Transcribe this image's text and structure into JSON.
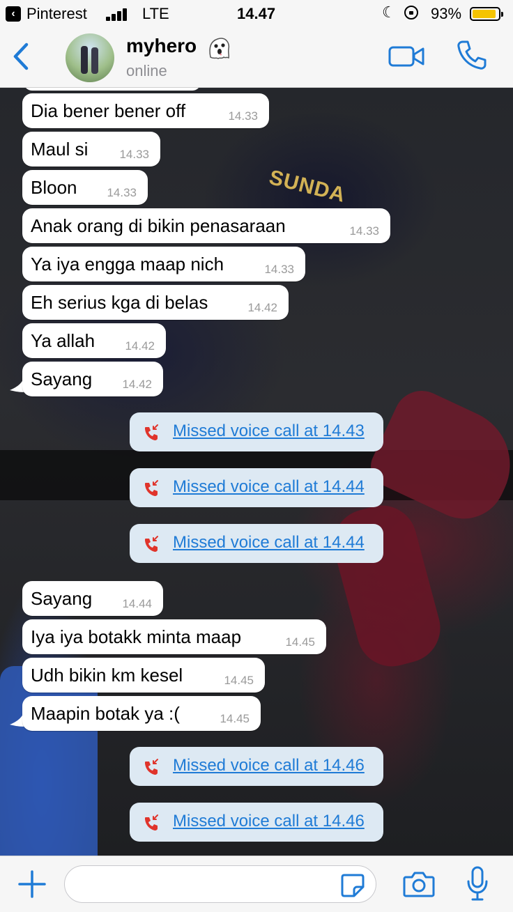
{
  "status_bar": {
    "back_app": "Pinterest",
    "network": "LTE",
    "time": "14.47",
    "battery_percent": "93%",
    "battery_level": 0.93
  },
  "header": {
    "contact_name": "myhero",
    "contact_status": "online",
    "icons": [
      "back-chevron-icon",
      "ghost-emoji-icon",
      "video-call-icon",
      "phone-icon"
    ]
  },
  "messages": [
    {
      "type": "text",
      "text": "Dia bener bener off",
      "time": "14.33"
    },
    {
      "type": "text",
      "text": "Maul si",
      "time": "14.33"
    },
    {
      "type": "text",
      "text": "Bloon",
      "time": "14.33"
    },
    {
      "type": "text",
      "text": "Anak orang di bikin penasaraan",
      "time": "14.33"
    },
    {
      "type": "text",
      "text": "Ya iya engga maap nich",
      "time": "14.33"
    },
    {
      "type": "text",
      "text": "Eh serius kga di belas",
      "time": "14.42"
    },
    {
      "type": "text",
      "text": "Ya allah",
      "time": "14.42"
    },
    {
      "type": "text",
      "text": "Sayang",
      "time": "14.42"
    },
    {
      "type": "call",
      "text": "Missed voice call at 14.43"
    },
    {
      "type": "call",
      "text": "Missed voice call at 14.44"
    },
    {
      "type": "call",
      "text": "Missed voice call at 14.44"
    },
    {
      "type": "text",
      "text": "Sayang",
      "time": "14.44"
    },
    {
      "type": "text",
      "text": "Iya iya botakk minta maap",
      "time": "14.45"
    },
    {
      "type": "text",
      "text": "Udh bikin km kesel",
      "time": "14.45"
    },
    {
      "type": "text",
      "text": "Maapin botak ya :(",
      "time": "14.45"
    },
    {
      "type": "call",
      "text": "Missed voice call at 14.46"
    },
    {
      "type": "call",
      "text": "Missed voice call at 14.46"
    }
  ],
  "background_text": "SUNDA",
  "input_bar": {
    "placeholder": "",
    "icons": [
      "plus-icon",
      "sticker-icon",
      "camera-icon",
      "microphone-icon"
    ]
  },
  "colors": {
    "accent": "#1f7bd6",
    "missed_call_red": "#e0342b",
    "call_bubble": "#dde9f3",
    "bar_background": "#f6f6f6"
  }
}
